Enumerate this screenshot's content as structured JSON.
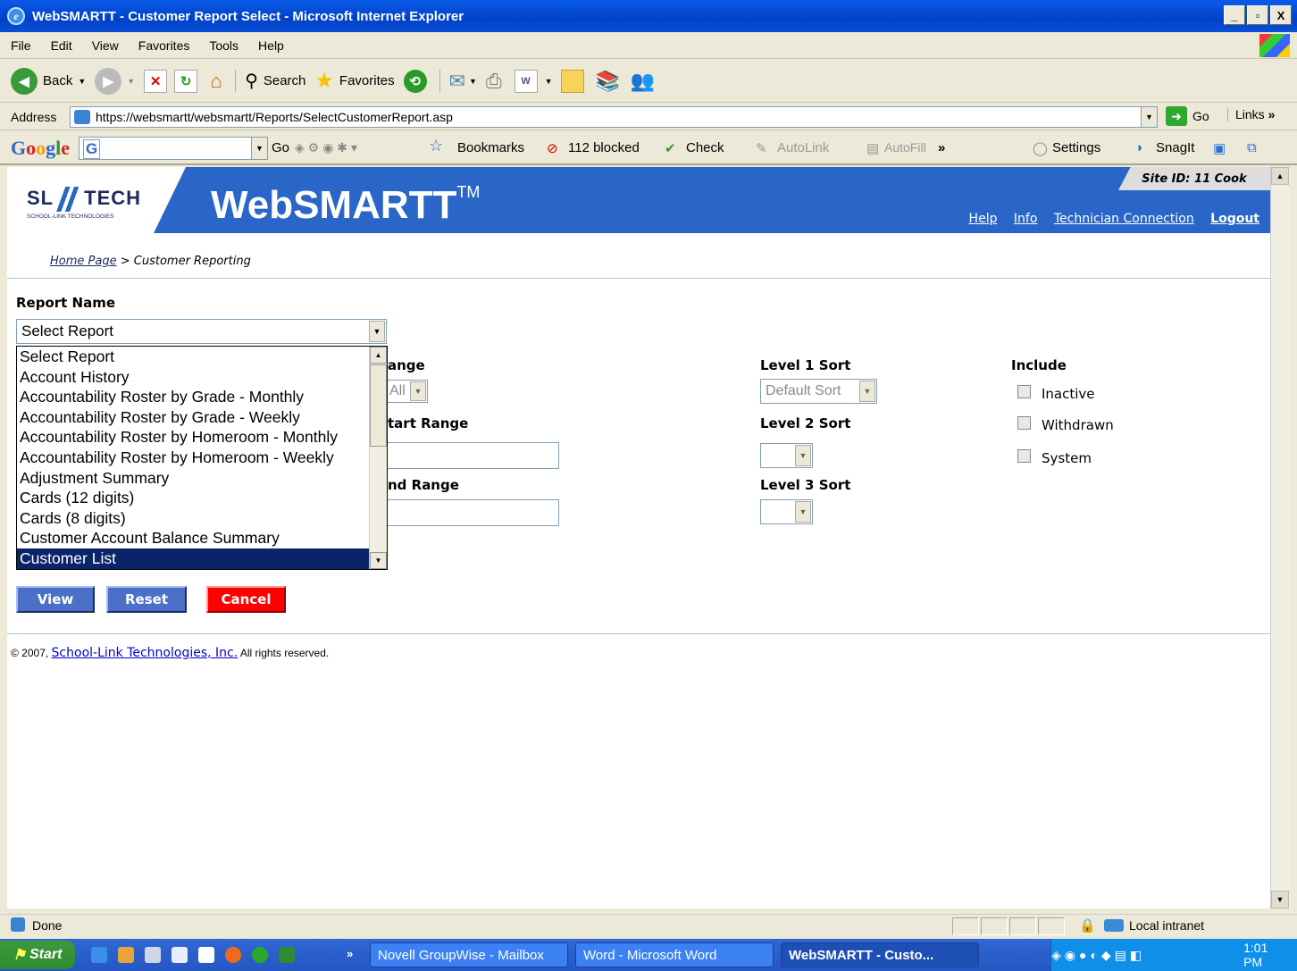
{
  "window": {
    "title": "WebSMARTT - Customer Report Select - Microsoft Internet Explorer",
    "controls": [
      "_",
      "▫",
      "X"
    ]
  },
  "menu": [
    "File",
    "Edit",
    "View",
    "Favorites",
    "Tools",
    "Help"
  ],
  "toolbar": {
    "back": "Back",
    "search": "Search",
    "favorites": "Favorites"
  },
  "address": {
    "label": "Address",
    "url": "https://websmartt/websmartt/Reports/SelectCustomerReport.asp",
    "go": "Go",
    "links": "Links"
  },
  "googlebar": {
    "logo": "Google",
    "go": "Go",
    "bookmarks": "Bookmarks",
    "blocked": "112 blocked",
    "check": "Check",
    "autolink": "AutoLink",
    "autofill": "AutoFill",
    "settings": "Settings",
    "snagit": "SnagIt"
  },
  "site": {
    "logo_main": "SL",
    "logo_tech": "TECH",
    "logo_sub": "SCHOOL-LINK TECHNOLOGIES",
    "brand": "WebSMARTT",
    "tm": "TM",
    "site_id": "Site ID: 11 Cook",
    "links": [
      "Help",
      "Info",
      "Technician Connection",
      "Logout"
    ]
  },
  "breadcrumb": {
    "home": "Home Page",
    "sep": " > ",
    "current": "Customer Reporting"
  },
  "form": {
    "report_name_label": "Report Name",
    "report_select_value": "Select Report",
    "range_label": "ange",
    "range_value": "All",
    "start_range_label": "tart Range",
    "end_range_label": "nd Range",
    "level1_label": "Level 1 Sort",
    "level1_value": "Default Sort",
    "level2_label": "Level 2 Sort",
    "level3_label": "Level 3 Sort",
    "include_label": "Include",
    "include_options": [
      "Inactive",
      "Withdrawn",
      "System"
    ]
  },
  "report_options": [
    "Select Report",
    "Account History",
    "Accountability Roster by Grade - Monthly",
    "Accountability Roster by Grade - Weekly",
    "Accountability Roster by Homeroom - Monthly",
    "Accountability Roster by Homeroom - Weekly",
    "Adjustment Summary",
    "Cards (12 digits)",
    "Cards (8 digits)",
    "Customer Account Balance Summary",
    "Customer List"
  ],
  "buttons": {
    "view": "View",
    "reset": "Reset",
    "cancel": "Cancel"
  },
  "footer": {
    "prefix": "© 2007, ",
    "company": "School-Link Technologies, Inc.",
    "suffix": " All rights reserved."
  },
  "status": {
    "text": "Done",
    "zone": "Local intranet"
  },
  "taskbar": {
    "start": "Start",
    "tasks": [
      "Novell GroupWise - Mailbox",
      "Word - Microsoft Word",
      "WebSMARTT - Custo..."
    ],
    "time": "1:01 PM"
  }
}
